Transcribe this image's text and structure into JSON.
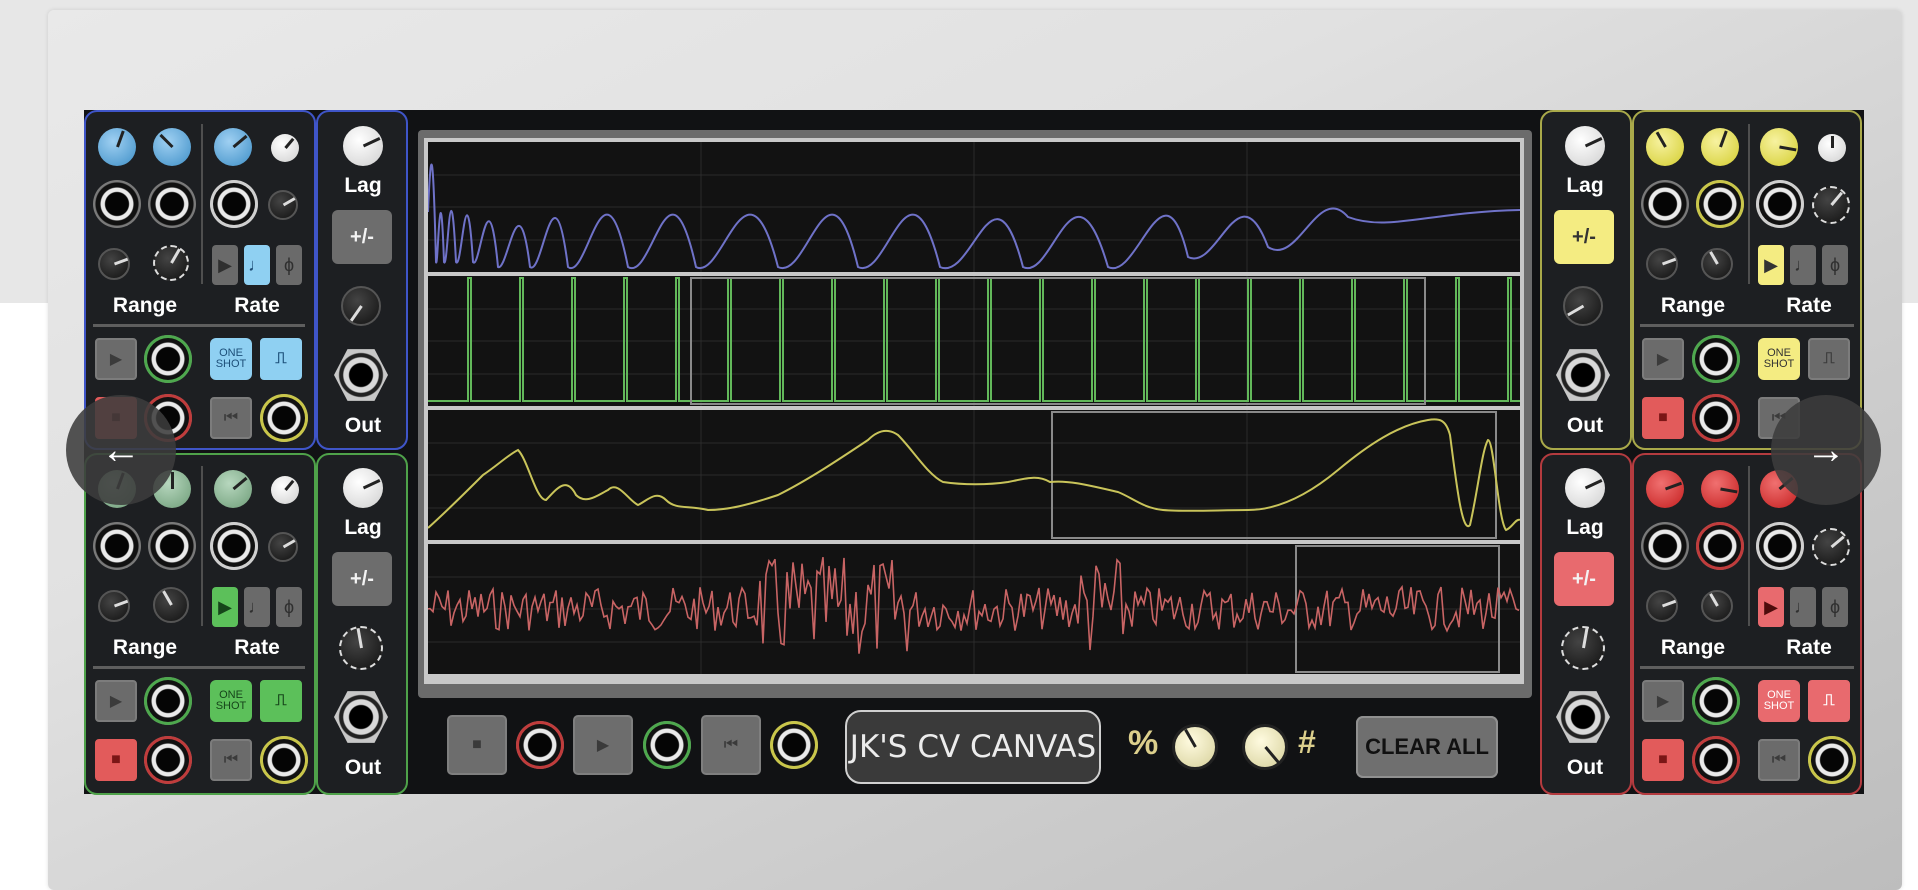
{
  "canvas_title": "JK'S CV CANVAS",
  "clear_all_label": "CLEAR ALL",
  "percent_symbol": "%",
  "hash_symbol": "#",
  "nav": {
    "prev_arrow": "←",
    "next_arrow": "→"
  },
  "channel_labels": {
    "range": "Range",
    "rate": "Rate",
    "lag": "Lag",
    "plus_minus": "+/-",
    "out": "Out",
    "one_shot": "ONE SHOT",
    "note_glyph": "♩",
    "phase_glyph": "ϕ"
  },
  "channels": [
    {
      "color": "blue",
      "hex": "#3f55c8",
      "knob_hex": "#5aa0d6"
    },
    {
      "color": "green",
      "hex": "#4fa24a",
      "knob_hex": "#7aa882"
    },
    {
      "color": "yellow",
      "hex": "#a9a94a",
      "knob_hex": "#e6e34f"
    },
    {
      "color": "red",
      "hex": "#b43b3f",
      "knob_hex": "#d8282a"
    }
  ],
  "waveform_colors": {
    "blue": "#6f72c8",
    "green": "#62b85a",
    "yellow": "#c9c45a",
    "red": "#c86464"
  },
  "icons": [
    "stop-icon",
    "play-icon",
    "rewind-icon",
    "pulse-icon",
    "note-icon",
    "phase-icon",
    "arrow-left-icon",
    "arrow-right-icon"
  ]
}
